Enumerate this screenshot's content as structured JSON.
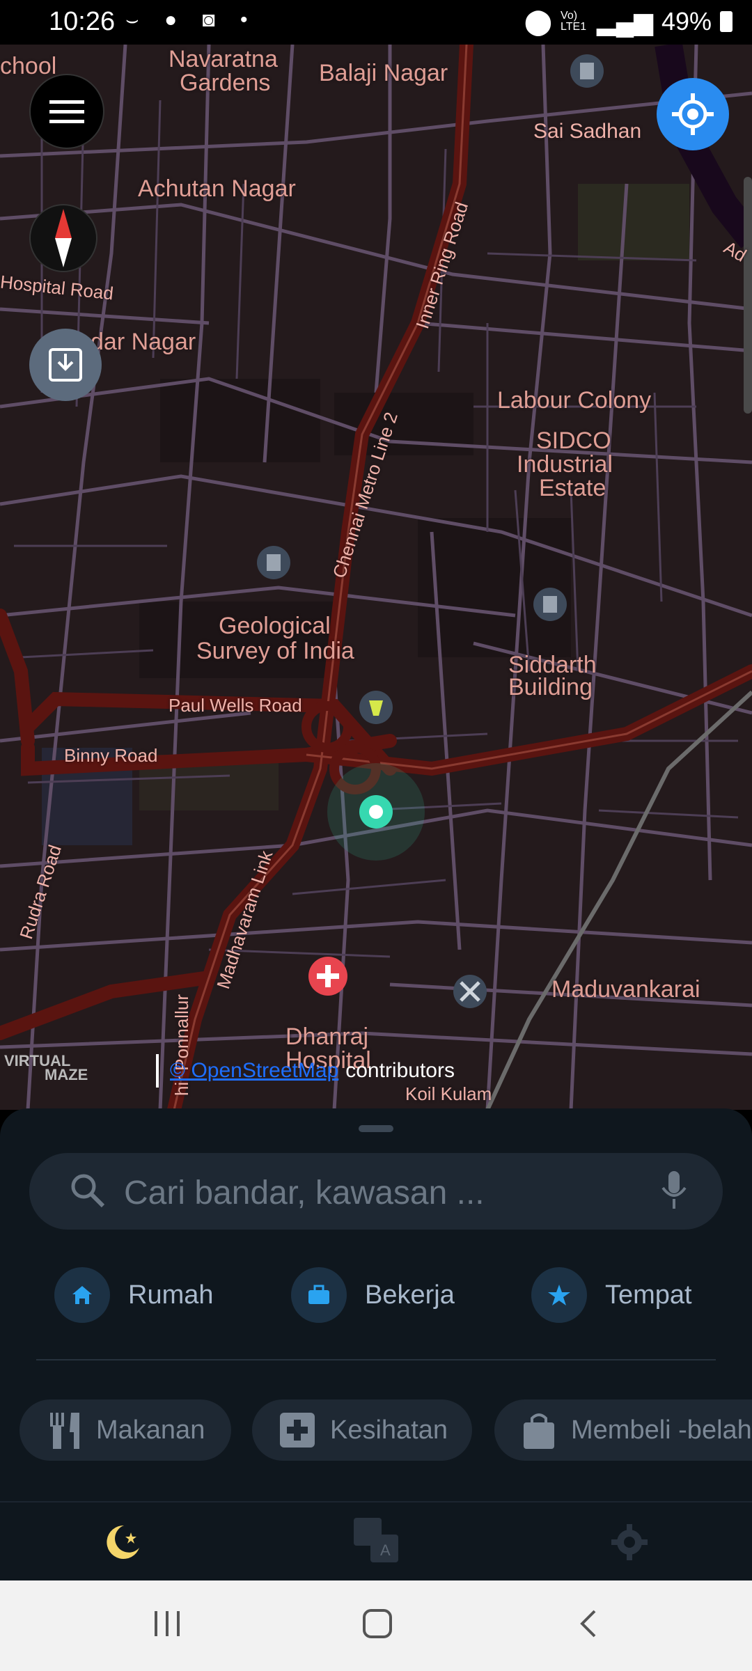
{
  "status": {
    "time": "10:26",
    "left_icons": [
      "signal-smile-icon",
      "account-circle-icon",
      "instagram-icon",
      "dot-icon"
    ],
    "network": "Vo) LTE1",
    "battery": "49%"
  },
  "map": {
    "labels": [
      {
        "text": "chool",
        "id": "school"
      },
      {
        "text": "Navaratna",
        "id": "navaratna-1"
      },
      {
        "text": "Gardens",
        "id": "navaratna-2"
      },
      {
        "text": "Balaji Nagar",
        "id": "balaji"
      },
      {
        "text": "Sai Sadhan",
        "id": "saisadhan"
      },
      {
        "text": "Achutan Nagar",
        "id": "achutan"
      },
      {
        "text": "Hospital Road",
        "id": "hospital-road"
      },
      {
        "text": "dar Nagar",
        "id": "dar-nagar"
      },
      {
        "text": "Inner Ring Road",
        "id": "inner-ring"
      },
      {
        "text": "Labour Colony",
        "id": "labour"
      },
      {
        "text": "SIDCO",
        "id": "sidco-1"
      },
      {
        "text": "Industrial",
        "id": "sidco-2"
      },
      {
        "text": "Estate",
        "id": "sidco-3"
      },
      {
        "text": "Chennai Metro Line 2",
        "id": "metro"
      },
      {
        "text": "Geological",
        "id": "geo-1"
      },
      {
        "text": "Survey of India",
        "id": "geo-2"
      },
      {
        "text": "Siddarth",
        "id": "siddarth-1"
      },
      {
        "text": "Building",
        "id": "siddarth-2"
      },
      {
        "text": "Paul Wells Road",
        "id": "paulwells"
      },
      {
        "text": "Binny Road",
        "id": "binny"
      },
      {
        "text": "Rudra Road",
        "id": "rudra"
      },
      {
        "text": "Madhavaram Link",
        "id": "madhavaram"
      },
      {
        "text": "Maduvankarai",
        "id": "maduvankarai"
      },
      {
        "text": "Dhanraj",
        "id": "dhanraj-1"
      },
      {
        "text": "Hospital",
        "id": "dhanraj-2"
      },
      {
        "text": "Koil Kulam",
        "id": "koilkulam"
      },
      {
        "text": "hir Ponnallur",
        "id": "ponnallur"
      },
      {
        "text": "Ad",
        "id": "ad"
      }
    ],
    "attribution": {
      "logo_line1": "VIRTUAL",
      "logo_line2": "MAZE",
      "osm_link": "© OpenStreetMap",
      "contributors": "contributors"
    }
  },
  "controls": {
    "menu": "menu-icon",
    "compass": "compass-icon",
    "layers": "map-download-icon",
    "locate": "my-location-icon"
  },
  "search": {
    "placeholder": "Cari bandar, kawasan ..."
  },
  "favorites": [
    {
      "label": "Rumah",
      "icon": "home-icon"
    },
    {
      "label": "Bekerja",
      "icon": "briefcase-icon"
    },
    {
      "label": "Tempat",
      "icon": "star-icon"
    }
  ],
  "categories": [
    {
      "label": "Makanan",
      "icon": "fork-knife-icon"
    },
    {
      "label": "Kesihatan",
      "icon": "medical-cross-icon"
    },
    {
      "label": "Membeli -belah",
      "icon": "shopping-bag-icon"
    }
  ],
  "bottom_nav": [
    "night-mode-icon",
    "translate-icon",
    "settings-icon"
  ],
  "colors": {
    "map_bg": "#241a1c",
    "major_road": "#5a1410",
    "minor_road": "#5f4d66",
    "label": "#e09e95",
    "accent": "#2a8cf0",
    "position": "#36d8b0",
    "sheet_bg": "#0f171e"
  }
}
